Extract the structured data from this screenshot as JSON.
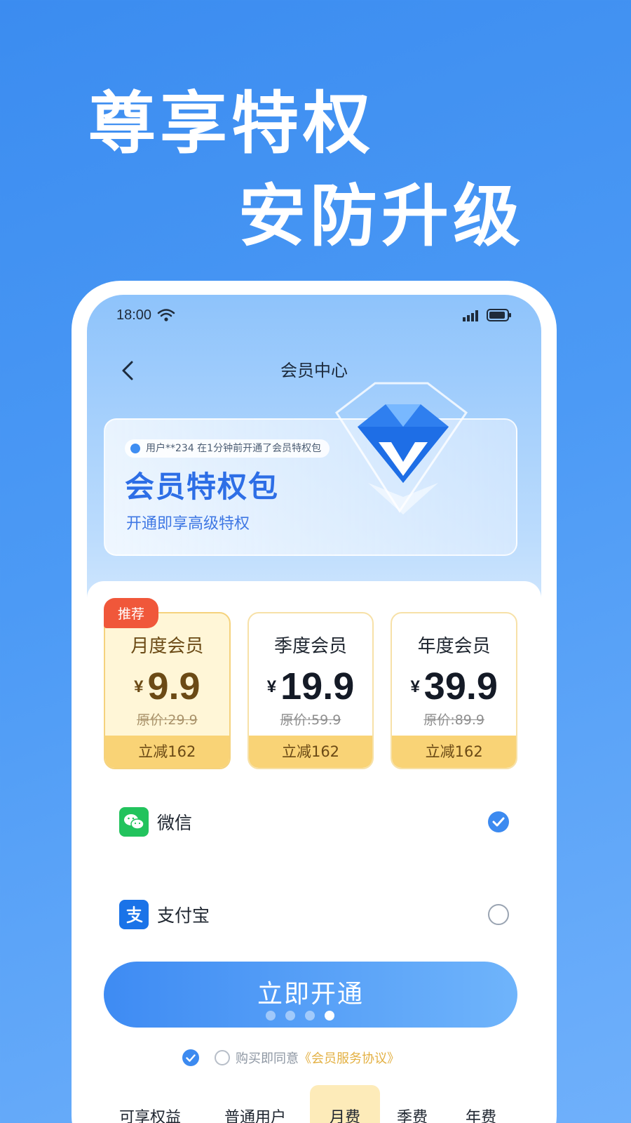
{
  "hero": {
    "line1": "尊享特权",
    "line2": "安防升级"
  },
  "status": {
    "time": "18:00"
  },
  "nav": {
    "title": "会员中心"
  },
  "banner": {
    "notice": "用户**234 在1分钟前开通了会员特权包",
    "title": "会员特权包",
    "subtitle": "开通即享高级特权"
  },
  "plans": [
    {
      "tag": "推荐",
      "name": "月度会员",
      "currency": "¥",
      "price": "9.9",
      "original": "原价:29.9",
      "save": "立减162",
      "selected": true
    },
    {
      "name": "季度会员",
      "currency": "¥",
      "price": "19.9",
      "original": "原价:59.9",
      "save": "立减162",
      "selected": false
    },
    {
      "name": "年度会员",
      "currency": "¥",
      "price": "39.9",
      "original": "原价:89.9",
      "save": "立减162",
      "selected": false
    }
  ],
  "payment": [
    {
      "label": "微信",
      "icon": "wechat-icon",
      "selected": true
    },
    {
      "label": "支付宝",
      "icon": "alipay-icon",
      "selected": false
    }
  ],
  "cta": {
    "label": "立即开通"
  },
  "carousel": {
    "count": 4,
    "active": 4
  },
  "agreement": {
    "text": "购买即同意",
    "link": "《会员服务协议》"
  },
  "compare_tabs": [
    "可享权益",
    "普通用户",
    "月费",
    "季费",
    "年费"
  ],
  "colors": {
    "brand": "#3c8af0",
    "gold": "#f9d376",
    "tag": "#f0573a"
  }
}
